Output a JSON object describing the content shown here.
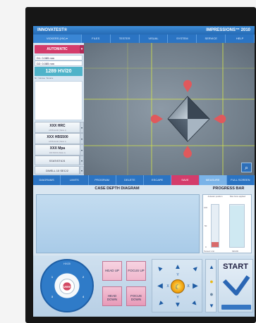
{
  "header": {
    "brand": "INNOVATEST®",
    "product": "IMPRESSIONS™ 2010"
  },
  "menu": {
    "scale_select": "VICKERS (HV)",
    "items": [
      "FILES",
      "TESTER",
      "VISUAL",
      "SYSTEM",
      "SERVICE",
      "HELP"
    ]
  },
  "left": {
    "mode": "AUTOMATIC",
    "d1": "D1: 0.085 mm",
    "d2": "D2: 0.085 mm",
    "hardness": "1289 HV/20",
    "cols": "Nr   Value   Scale",
    "conversions": [
      {
        "main": "XXX HRC",
        "sub": "ASTM E140 (Table 1)"
      },
      {
        "main": "XXX HBS500",
        "sub": "ASTM E140 (Table 1)"
      },
      {
        "main": "XXX Mpa",
        "sub": "DIN 50150 (Table 1)"
      }
    ],
    "statistics": "STATISTICS",
    "last": "DWELL 10 SEC/2"
  },
  "bottom_tabs": [
    "DIAGRAMS",
    "LIMITS",
    "PROGRAM",
    "DELETE",
    "ESCAPE",
    "SAVE",
    "MEASURE",
    "FULL SCREEN"
  ],
  "case_depth": {
    "title": "CASE DEPTH DIAGRAM"
  },
  "progress": {
    "title": "PROGRESS BAR",
    "left_label": "Actuator position",
    "right_label": "Max force applied",
    "ticks": [
      "100",
      "50",
      "0"
    ],
    "left_fill": 0.12,
    "right_fill": 0.98,
    "bottom_left": "Tested Unit",
    "bottom_right": "MFMD"
  },
  "controls": {
    "dial_title": "HV/20",
    "dial_center": "TURRET",
    "dial_nums": [
      "1",
      "2",
      "3",
      "4"
    ],
    "head_up": "HEAD UP",
    "head_down": "HEAD DOWN",
    "focus_up": "FOCUS UP",
    "focus_down": "FOCUS DOWN",
    "start": "START",
    "x_label": "X",
    "y_label": "Y"
  },
  "colors": {
    "accent": "#d43c6b",
    "menu": "#2b74c3",
    "header": "#2469b3"
  }
}
